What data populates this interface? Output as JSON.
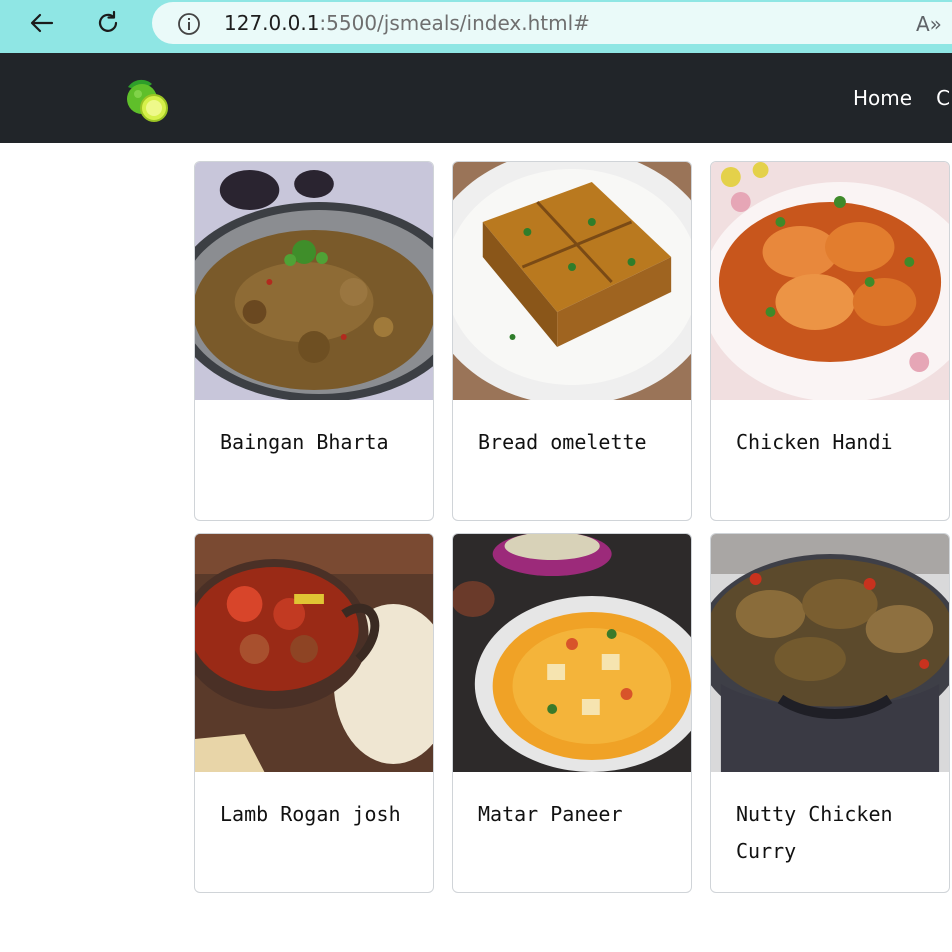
{
  "browser": {
    "url_host": "127.0.0.1",
    "url_rest": ":5500/jsmeals/index.html#",
    "read_aloud_label": "A»"
  },
  "navbar": {
    "links": [
      "Home",
      "C"
    ]
  },
  "meals": [
    {
      "name": "Baingan Bharta",
      "image": "baingan-bharta-photo"
    },
    {
      "name": "Bread omelette",
      "image": "bread-omelette-photo"
    },
    {
      "name": "Chicken Handi",
      "image": "chicken-handi-photo"
    },
    {
      "name": "Lamb Rogan josh",
      "image": "lamb-rogan-josh-photo"
    },
    {
      "name": "Matar Paneer",
      "image": "matar-paneer-photo"
    },
    {
      "name": "Nutty Chicken Curry",
      "image": "nutty-chicken-curry-photo"
    }
  ]
}
